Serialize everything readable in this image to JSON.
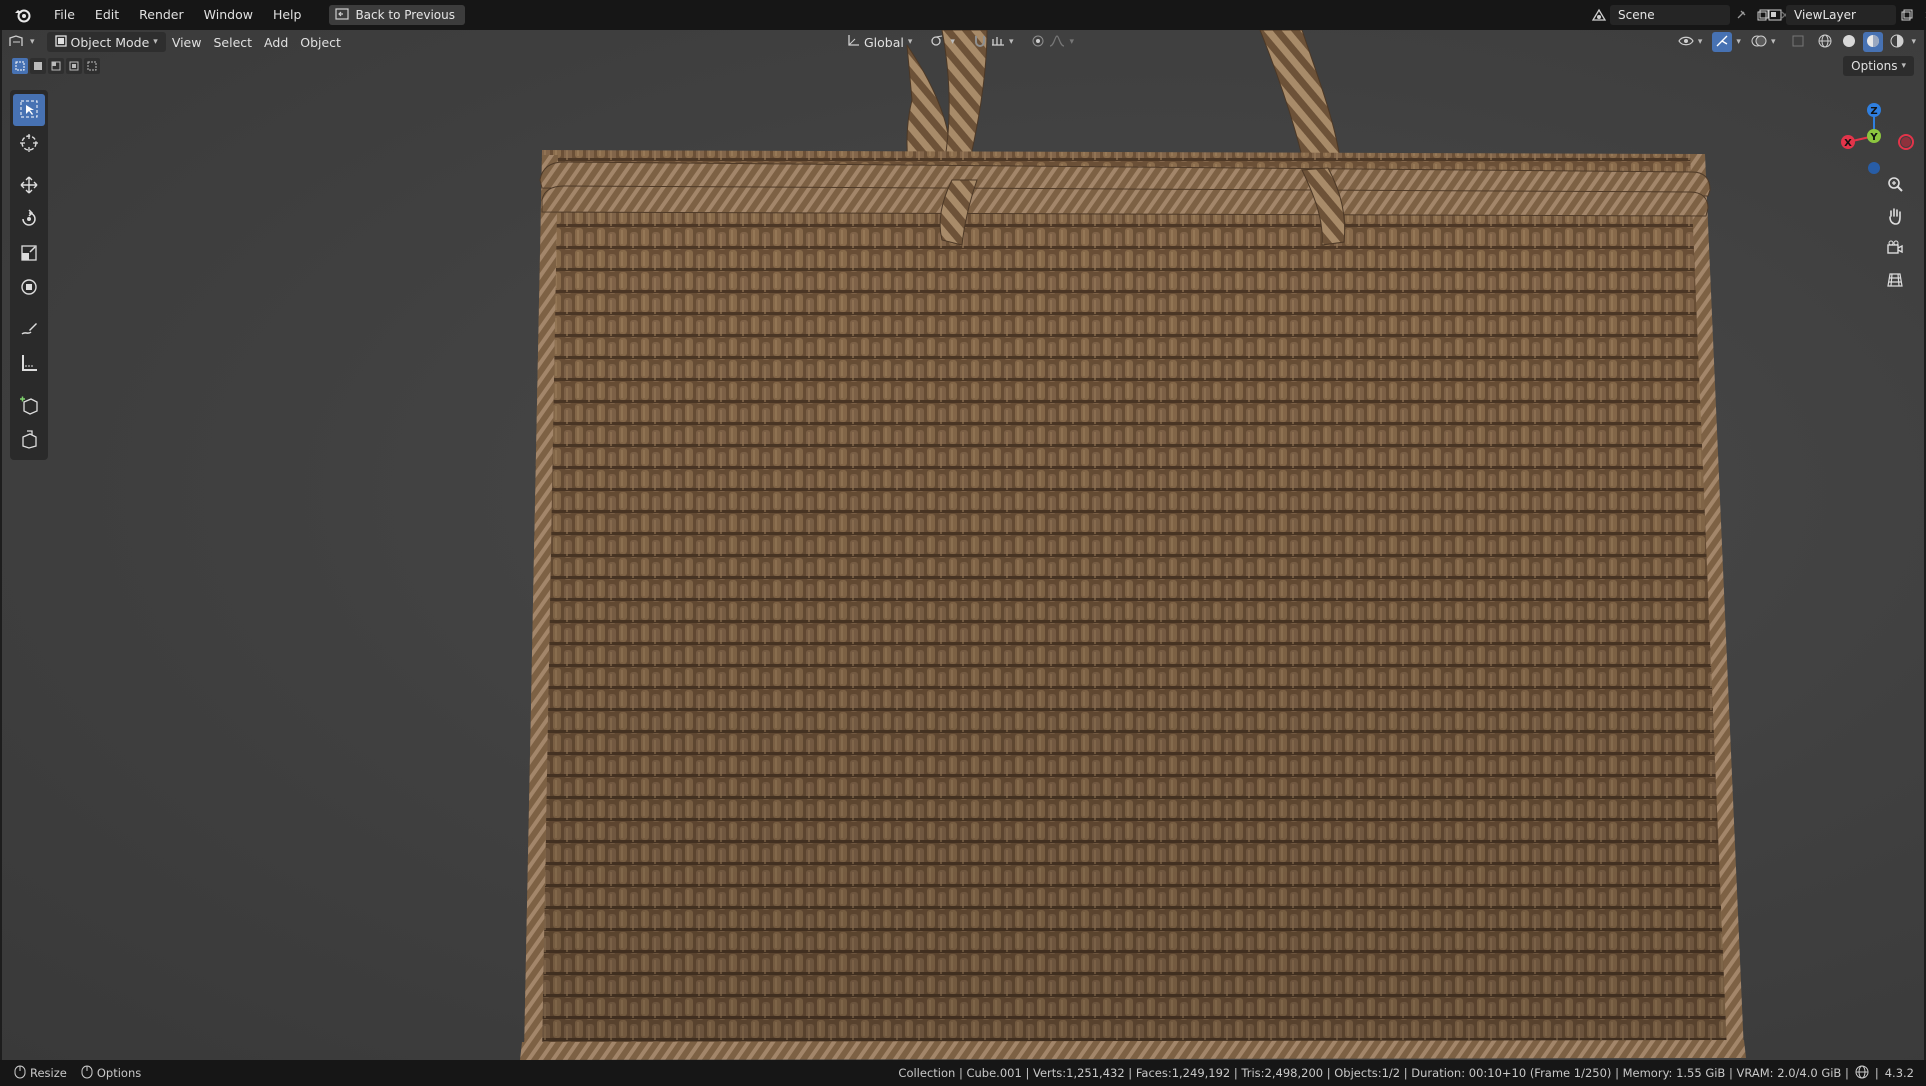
{
  "menubar": {
    "items": [
      "File",
      "Edit",
      "Render",
      "Window",
      "Help"
    ],
    "back_button": "Back to Previous",
    "scene": "Scene",
    "view_layer": "ViewLayer"
  },
  "viewport_header": {
    "editor_type_icon": "3d-viewport-icon",
    "mode": "Object Mode",
    "menus": [
      "View",
      "Select",
      "Add",
      "Object"
    ],
    "transform_orientation": "Global",
    "options_label": "Options"
  },
  "toolbar": {
    "tools": [
      "select-box",
      "cursor",
      "move",
      "rotate",
      "scale",
      "transform",
      "annotate",
      "measure",
      "add-cube",
      "extrude"
    ]
  },
  "gizmo": {
    "axes": [
      "X",
      "Y",
      "Z"
    ],
    "colors": {
      "x": "#e3344a",
      "y": "#8cc63f",
      "z": "#2f7fe0"
    }
  },
  "statusbar": {
    "left": [
      {
        "key": "resize",
        "label": "Resize"
      },
      {
        "key": "options",
        "label": "Options"
      }
    ],
    "info": "Collection | Cube.001 | Verts:1,251,432 | Faces:1,249,192 | Tris:2,498,200 | Objects:1/2 | Duration: 00:10+10 (Frame 1/250) | Memory: 1.55 GiB | VRAM: 2.0/4.0 GiB |",
    "version": "4.3.2"
  },
  "theme": {
    "accent": "#4772b3",
    "viewport_bg": "#404040",
    "basket_color": "#7b5f42"
  }
}
